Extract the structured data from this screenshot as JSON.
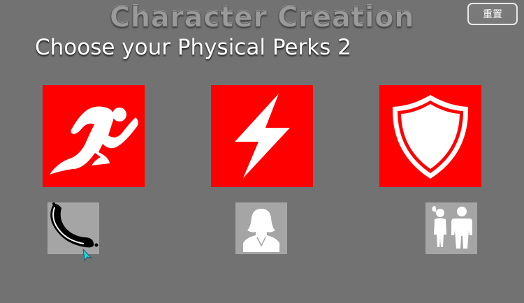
{
  "header": {
    "title": "Character Creation",
    "subtitle": "Choose your Physical Perks 2",
    "reset_label": "重置"
  },
  "perks": [
    {
      "icon": "running-person-icon",
      "color": "#ff0000"
    },
    {
      "icon": "lightning-bolt-icon",
      "color": "#ff0000"
    },
    {
      "icon": "shield-icon",
      "color": "#ff0000"
    }
  ],
  "options": [
    {
      "icon": "sausage-icon"
    },
    {
      "icon": "female-avatar-icon"
    },
    {
      "icon": "man-and-woman-icon"
    }
  ],
  "colors": {
    "background": "#727272",
    "perk_tile": "#ff0000",
    "option_tile": "#a5a5a5"
  }
}
